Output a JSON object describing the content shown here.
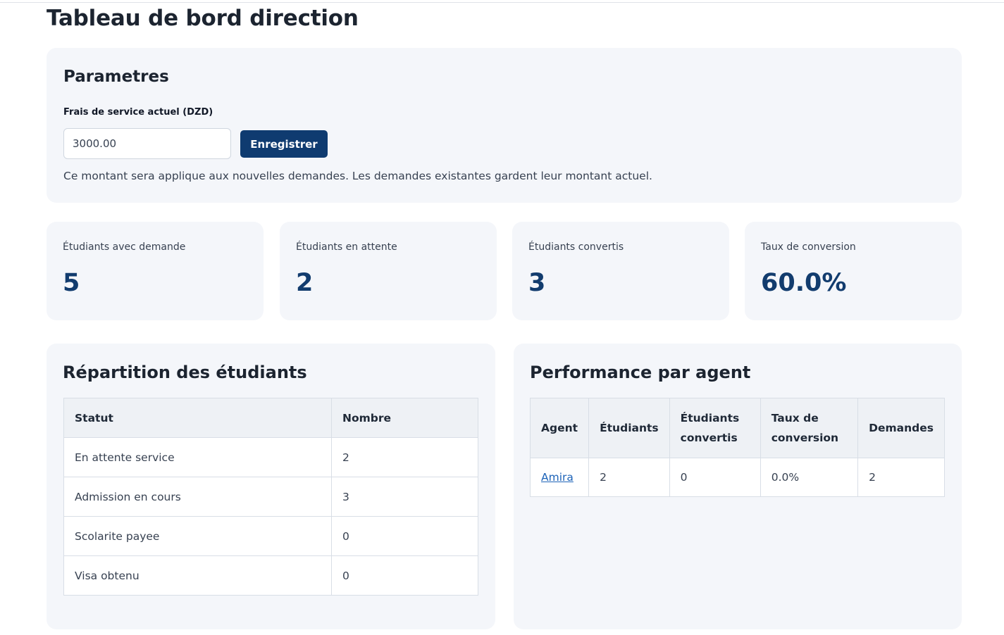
{
  "page": {
    "title": "Tableau de bord direction"
  },
  "settings": {
    "title": "Parametres",
    "fee_label": "Frais de service actuel (DZD)",
    "fee_value": "3000.00",
    "save_label": "Enregistrer",
    "help_text": "Ce montant sera applique aux nouvelles demandes. Les demandes existantes gardent leur montant actuel."
  },
  "stats": [
    {
      "label": "Étudiants avec demande",
      "value": "5"
    },
    {
      "label": "Étudiants en attente",
      "value": "2"
    },
    {
      "label": "Étudiants convertis",
      "value": "3"
    },
    {
      "label": "Taux de conversion",
      "value": "60.0%"
    }
  ],
  "distribution": {
    "title": "Répartition des étudiants",
    "headers": [
      "Statut",
      "Nombre"
    ],
    "rows": [
      [
        "En attente service",
        "2"
      ],
      [
        "Admission en cours",
        "3"
      ],
      [
        "Scolarite payee",
        "0"
      ],
      [
        "Visa obtenu",
        "0"
      ]
    ]
  },
  "agents": {
    "title": "Performance par agent",
    "headers": [
      "Agent",
      "Étudiants",
      "Étudiants convertis",
      "Taux de conversion",
      "Demandes"
    ],
    "rows": [
      [
        "Amira",
        "2",
        "0",
        "0.0%",
        "2"
      ]
    ]
  },
  "colors": {
    "accent": "#0f3b70",
    "stat_value": "#123c6e",
    "card_bg": "#f4f6fa",
    "link": "#1d63b8"
  }
}
